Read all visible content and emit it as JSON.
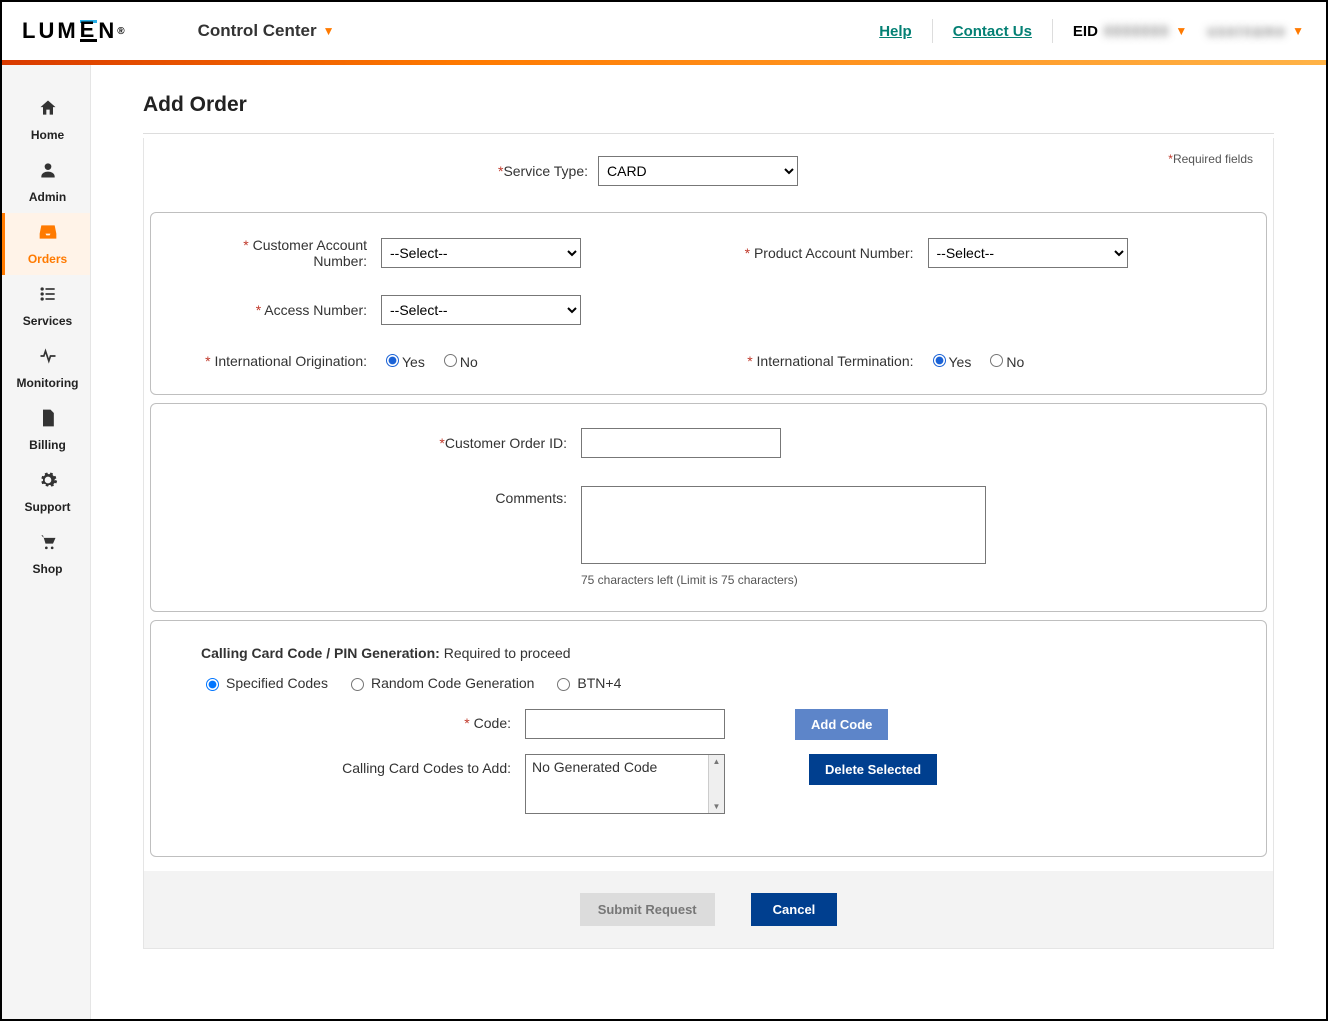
{
  "header": {
    "brand": "LUMEN",
    "product": "Control Center",
    "help": "Help",
    "contact": "Contact Us",
    "eid_label": "EID",
    "eid_value": "0000000",
    "user_name": "username"
  },
  "sidebar": {
    "items": [
      {
        "label": "Home",
        "icon": "home"
      },
      {
        "label": "Admin",
        "icon": "user"
      },
      {
        "label": "Orders",
        "icon": "inbox"
      },
      {
        "label": "Services",
        "icon": "list"
      },
      {
        "label": "Monitoring",
        "icon": "pulse"
      },
      {
        "label": "Billing",
        "icon": "file"
      },
      {
        "label": "Support",
        "icon": "gear"
      },
      {
        "label": "Shop",
        "icon": "cart"
      }
    ],
    "active_index": 2
  },
  "page": {
    "title": "Add Order",
    "required_note": "Required fields",
    "service_type": {
      "label": "Service Type:",
      "value": "CARD",
      "options": [
        "CARD"
      ]
    },
    "customer_account": {
      "label": "Customer Account Number:",
      "value": "--Select--"
    },
    "product_account": {
      "label": "Product Account Number:",
      "value": "--Select--"
    },
    "access_number": {
      "label": "Access Number:",
      "value": "--Select--"
    },
    "intl_orig": {
      "label": "International Origination:",
      "yes": "Yes",
      "no": "No",
      "value": "Yes"
    },
    "intl_term": {
      "label": "International Termination:",
      "yes": "Yes",
      "no": "No",
      "value": "Yes"
    },
    "customer_order_id": {
      "label": "Customer Order ID:",
      "value": ""
    },
    "comments": {
      "label": "Comments:",
      "value": "",
      "hint": "75 characters left (Limit is 75 characters)"
    },
    "pin_section": {
      "heading_bold": "Calling Card Code / PIN Generation:",
      "heading_rest": " Required to proceed",
      "modes": {
        "specified": "Specified Codes",
        "random": "Random Code Generation",
        "btn4": "BTN+4",
        "selected": "specified"
      },
      "code_label": "Code:",
      "codes_to_add_label": "Calling Card Codes to Add:",
      "codes_placeholder": "No Generated Code",
      "add_code_btn": "Add Code",
      "delete_btn": "Delete Selected"
    },
    "submit_btn": "Submit Request",
    "cancel_btn": "Cancel"
  }
}
